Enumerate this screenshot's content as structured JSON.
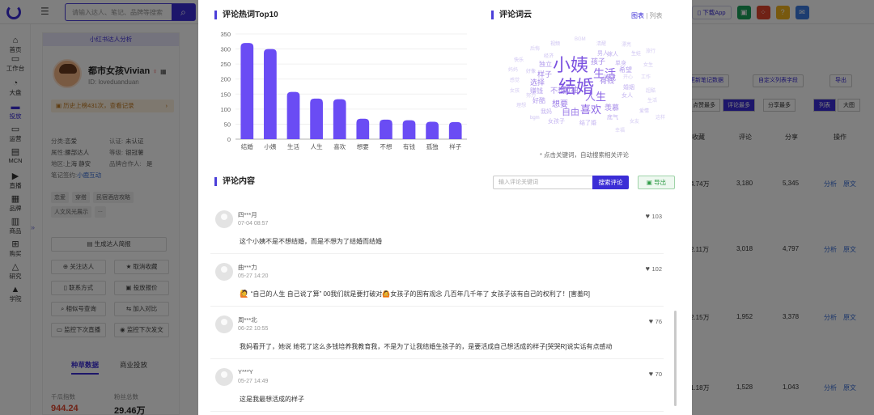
{
  "topbar": {
    "search_placeholder": "请输入达人、笔记、品牌等搜索",
    "download_app": "下载App"
  },
  "nav": {
    "items": [
      {
        "label": "首页",
        "icon": "home-icon"
      },
      {
        "label": "工作台",
        "icon": "workbench-icon"
      },
      {
        "label": "大盘",
        "icon": "dashboard-icon"
      },
      {
        "label": "投放",
        "icon": "folder-icon"
      },
      {
        "label": "运营",
        "icon": "chat-icon"
      },
      {
        "label": "MCN",
        "icon": "mcn-icon"
      },
      {
        "label": "直播",
        "icon": "video-icon"
      },
      {
        "label": "品牌",
        "icon": "shop-icon"
      },
      {
        "label": "商品",
        "icon": "bag-icon"
      },
      {
        "label": "购买",
        "icon": "cart-icon"
      },
      {
        "label": "研究",
        "icon": "flask-icon"
      },
      {
        "label": "学院",
        "icon": "graduation-icon"
      }
    ]
  },
  "profile": {
    "header": "小红书达人分析",
    "name": "都市女孩Vivian",
    "gender_symbol": "♀",
    "id_label": "ID: loveduanduan",
    "history": "历史上榜431次，查看记录",
    "info": [
      {
        "k": "分类:",
        "v": "恋爱",
        "k2": "认证:",
        "v2": "未认证"
      },
      {
        "k": "属性:",
        "v": "腰部达人",
        "k2": "等级:",
        "v2": "银冠薯"
      },
      {
        "k": "地区:",
        "v": "上海 静安",
        "k2": "品牌合作人:",
        "v2": "是"
      },
      {
        "k": "笔记签约:",
        "v": "小鹿互动",
        "k2": "",
        "v2": ""
      }
    ],
    "tags": [
      "恋爱",
      "穿搭",
      "民宿酒店攻略",
      "人文风光展示",
      "..."
    ],
    "report_button": "生成达人简报",
    "buttons": [
      {
        "label": "关注达人",
        "icon": "plus-circle-icon"
      },
      {
        "label": "取消收藏",
        "icon": "star-icon"
      },
      {
        "label": "联系方式",
        "icon": "phone-icon"
      },
      {
        "label": "投放报价",
        "icon": "price-icon"
      },
      {
        "label": "相似号查询",
        "icon": "search-icon"
      },
      {
        "label": "加入对比",
        "icon": "compare-icon"
      },
      {
        "label": "监控下次直播",
        "icon": "monitor-icon"
      },
      {
        "label": "监控下次发文",
        "icon": "location-icon"
      }
    ],
    "tabs": [
      "种草数据",
      "商业投放"
    ],
    "stats": [
      {
        "label": "千瓜指数",
        "value": "944.24",
        "color": "#e0452c"
      },
      {
        "label": "粉丝总数",
        "value": "29.46万",
        "color": "#222222"
      }
    ]
  },
  "bg_table": {
    "buttons": [
      "更新笔记数据",
      "自定义列表字段",
      "导出"
    ],
    "sort_tabs": [
      "点赞最多",
      "评论最多",
      "分享最多"
    ],
    "view_tabs": [
      "列表",
      "大图"
    ],
    "headers": [
      "收藏",
      "评论",
      "分享",
      "操作"
    ],
    "rows": [
      {
        "collect": "4.74万",
        "comment": "3,180",
        "share": "5,345"
      },
      {
        "collect": "2.11万",
        "comment": "3,018",
        "share": "4,797"
      },
      {
        "collect": "2.15万",
        "comment": "1,952",
        "share": "3,378"
      },
      {
        "collect": "1.18万",
        "comment": "1,528",
        "share": "1,043"
      }
    ],
    "op_analyze": "分析",
    "op_original": "原文"
  },
  "modal": {
    "hotwords_title": "评论热词Top10",
    "cloud_title": "评论词云",
    "toggle_chart": "图表",
    "toggle_list": "列表",
    "toggle_sep": "|",
    "cloud_note": "* 点击关键词，自动搜索相关评论",
    "comments_title": "评论内容",
    "comment_search_placeholder": "输入评论关键词",
    "comment_search_btn": "搜索评论",
    "export_btn": "导出"
  },
  "chart_data": {
    "type": "bar",
    "categories": [
      "结婚",
      "小姨",
      "生活",
      "人生",
      "喜欢",
      "想要",
      "不想",
      "有钱",
      "孤独",
      "样子"
    ],
    "values": [
      320,
      300,
      157,
      135,
      133,
      68,
      65,
      63,
      58,
      57
    ],
    "ylim": [
      0,
      350
    ],
    "yticks": [
      0,
      50,
      100,
      150,
      200,
      250,
      300,
      350
    ],
    "color": "#6a4cf4",
    "grid": true
  },
  "word_cloud": [
    {
      "w": "小姨",
      "s": 22,
      "c": "#7b52e0"
    },
    {
      "w": "结婚",
      "s": 22,
      "c": "#7b52e0"
    },
    {
      "w": "生活",
      "s": 14,
      "c": "#8c66e6"
    },
    {
      "w": "人生",
      "s": 13,
      "c": "#8c66e6"
    },
    {
      "w": "喜欢",
      "s": 13,
      "c": "#8c66e6"
    },
    {
      "w": "自由",
      "s": 11,
      "c": "#9c7ce8"
    },
    {
      "w": "想要",
      "s": 10,
      "c": "#9c7ce8"
    },
    {
      "w": "孤独",
      "s": 10,
      "c": "#9c7ce8"
    },
    {
      "w": "选择",
      "s": 9,
      "c": "#a58ae8"
    },
    {
      "w": "不想",
      "s": 9,
      "c": "#a58ae8"
    },
    {
      "w": "孩子",
      "s": 9,
      "c": "#a58ae8"
    },
    {
      "w": "有钱",
      "s": 9,
      "c": "#a58ae8"
    },
    {
      "w": "活成",
      "s": 8,
      "c": "#b29ced"
    },
    {
      "w": "羡慕",
      "s": 9,
      "c": "#a58ae8"
    },
    {
      "w": "样子",
      "s": 9,
      "c": "#a58ae8"
    },
    {
      "w": "独立",
      "s": 8,
      "c": "#b29ced"
    },
    {
      "w": "赚钱",
      "s": 8,
      "c": "#b29ced"
    },
    {
      "w": "希望",
      "s": 8,
      "c": "#b29ced"
    },
    {
      "w": "嫁人",
      "s": 7,
      "c": "#c3b3f0"
    },
    {
      "w": "好酷",
      "s": 8,
      "c": "#b29ced"
    },
    {
      "w": "男人",
      "s": 7,
      "c": "#c3b3f0"
    },
    {
      "w": "单身",
      "s": 7,
      "c": "#c3b3f0"
    },
    {
      "w": "女人",
      "s": 7,
      "c": "#c3b3f0"
    },
    {
      "w": "结了婚",
      "s": 7,
      "c": "#c3b3f0"
    },
    {
      "w": "我妈",
      "s": 7,
      "c": "#c3b3f0"
    },
    {
      "w": "女孩子",
      "s": 7,
      "c": "#c3b3f0"
    },
    {
      "w": "婚姻",
      "s": 7,
      "c": "#c3b3f0"
    },
    {
      "w": "底气",
      "s": 7,
      "c": "#c3b3f0"
    },
    {
      "w": "爱情",
      "s": 6,
      "c": "#cdc2f2"
    },
    {
      "w": "经济",
      "s": 6,
      "c": "#cdc2f2"
    },
    {
      "w": "快乐",
      "s": 6,
      "c": "#cdc2f2"
    },
    {
      "w": "好像",
      "s": 6,
      "c": "#cdc2f2"
    },
    {
      "w": "生娃",
      "s": 6,
      "c": "#cdc2f2"
    },
    {
      "w": "视频",
      "s": 6,
      "c": "#cdc2f2"
    },
    {
      "w": "BGM",
      "s": 6,
      "c": "#d5ccf3"
    },
    {
      "w": "bgm",
      "s": 6,
      "c": "#cdc2f2"
    },
    {
      "w": "清醒",
      "s": 6,
      "c": "#d5ccf3"
    },
    {
      "w": "后悔",
      "s": 6,
      "c": "#d5ccf3"
    },
    {
      "w": "开心",
      "s": 6,
      "c": "#d5ccf3"
    },
    {
      "w": "工作",
      "s": 6,
      "c": "#d5ccf3"
    },
    {
      "w": "女生",
      "s": 6,
      "c": "#d5ccf3"
    },
    {
      "w": "超酷",
      "s": 6,
      "c": "#d5ccf3"
    },
    {
      "w": "漂亮",
      "s": 6,
      "c": "#d5ccf3"
    },
    {
      "w": "幸福",
      "s": 6,
      "c": "#d5ccf3"
    },
    {
      "w": "女友",
      "s": 6,
      "c": "#d5ccf3"
    },
    {
      "w": "理想",
      "s": 6,
      "c": "#d5ccf3"
    },
    {
      "w": "努力",
      "s": 6,
      "c": "#d5ccf3"
    },
    {
      "w": "感觉",
      "s": 6,
      "c": "#d5ccf3"
    },
    {
      "w": "妈妈",
      "s": 6,
      "c": "#d5ccf3"
    },
    {
      "w": "生活",
      "s": 6,
      "c": "#d5ccf3"
    },
    {
      "w": "旅行",
      "s": 6,
      "c": "#d5ccf3"
    },
    {
      "w": "女孩",
      "s": 6,
      "c": "#d5ccf3"
    },
    {
      "w": "这样",
      "s": 6,
      "c": "#d5ccf3"
    }
  ],
  "comments": [
    {
      "user": "四***月",
      "time": "07-04 08:57",
      "text": "这个小姨不是不想结婚，而是不想为了结婚而结婚",
      "likes": "103",
      "emoji": false
    },
    {
      "user": "曲***力",
      "time": "05-27 14:20",
      "text": "“自己的人生 自己说了算” 00我们就是要打破对🙆女孩子的固有观念 几百年几千年了 女孩子该有自己的权利了！[害羞R]",
      "likes": "102",
      "emoji": true
    },
    {
      "user": "周***北",
      "time": "06-22 10:55",
      "text": "我妈看开了，她说 她花了这么多钱培养我教育我，不是为了让我结婚生孩子的，是要活成自己想活成的样子[哭哭R]说实话有点感动",
      "likes": "76",
      "emoji": false
    },
    {
      "user": "Y***Y",
      "time": "05-27 14:49",
      "text": "这是我最想活成的样子",
      "likes": "70",
      "emoji": false
    }
  ]
}
